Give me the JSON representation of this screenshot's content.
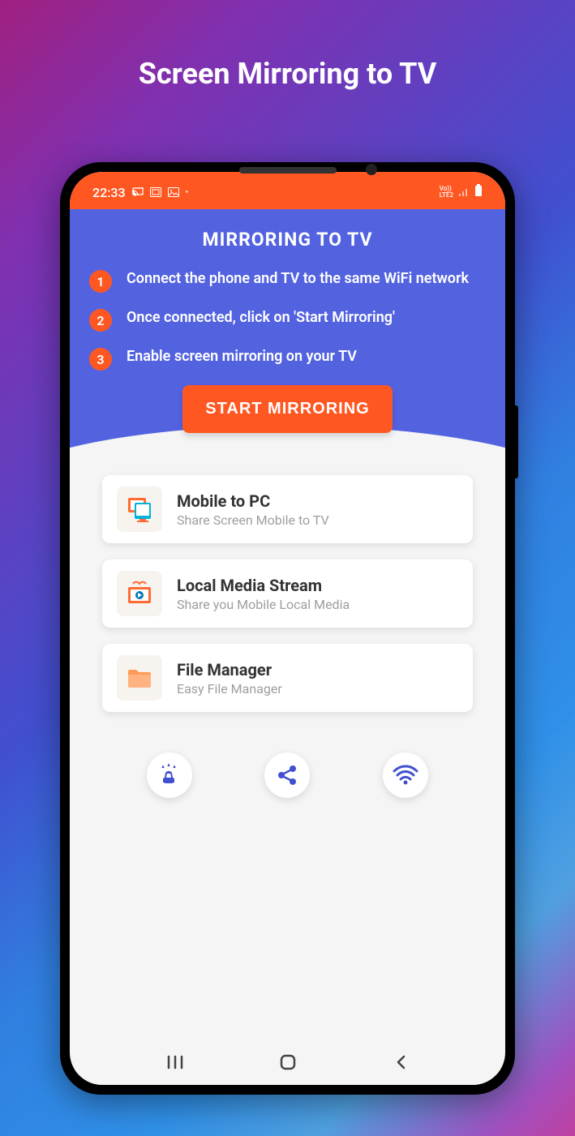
{
  "page": {
    "title": "Screen Mirroring to TV"
  },
  "statusBar": {
    "time": "22:33",
    "network": "LTE2"
  },
  "hero": {
    "title": "MIRRORING TO TV",
    "steps": [
      "Connect the phone and TV to the same WiFi network",
      "Once connected, click on 'Start Mirroring'",
      "Enable screen mirroring on your TV"
    ],
    "button": "START MIRRORING"
  },
  "cards": [
    {
      "title": "Mobile to PC",
      "subtitle": "Share Screen Mobile to TV"
    },
    {
      "title": "Local Media Stream",
      "subtitle": "Share you Mobile Local Media"
    },
    {
      "title": "File Manager",
      "subtitle": "Easy File Manager"
    }
  ]
}
